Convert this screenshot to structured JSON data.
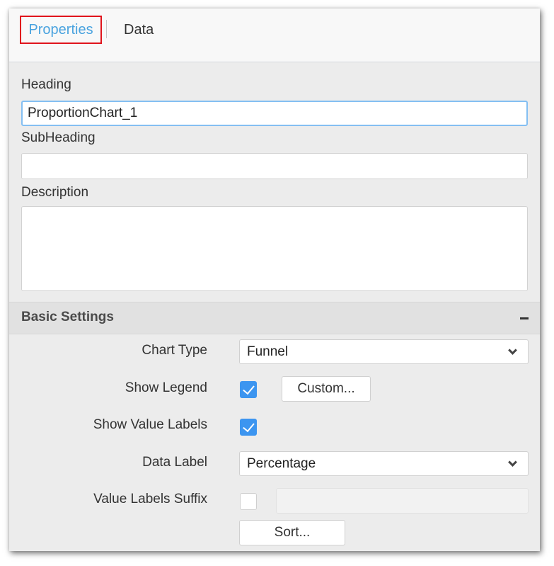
{
  "tabs": [
    {
      "label": "Properties",
      "active": true
    },
    {
      "label": "Data",
      "active": false
    }
  ],
  "fields": {
    "heading": {
      "label": "Heading",
      "value": "ProportionChart_1"
    },
    "subheading": {
      "label": "SubHeading",
      "value": ""
    },
    "description": {
      "label": "Description",
      "value": ""
    }
  },
  "basic_settings": {
    "title": "Basic Settings",
    "collapse_icon": "minus-icon",
    "chart_type": {
      "label": "Chart Type",
      "value": "Funnel"
    },
    "show_legend": {
      "label": "Show Legend",
      "checked": true,
      "button_label": "Custom..."
    },
    "show_value_labels": {
      "label": "Show Value Labels",
      "checked": true
    },
    "data_label": {
      "label": "Data Label",
      "value": "Percentage"
    },
    "value_labels_suffix": {
      "label": "Value Labels Suffix",
      "checked": false,
      "value": ""
    },
    "sort_button_label": "Sort..."
  },
  "colors": {
    "active_tab_text": "#4aa3df",
    "active_tab_outline": "#e0141c",
    "checkbox_checked": "#3c95f0",
    "focus_border": "#84bff2"
  }
}
